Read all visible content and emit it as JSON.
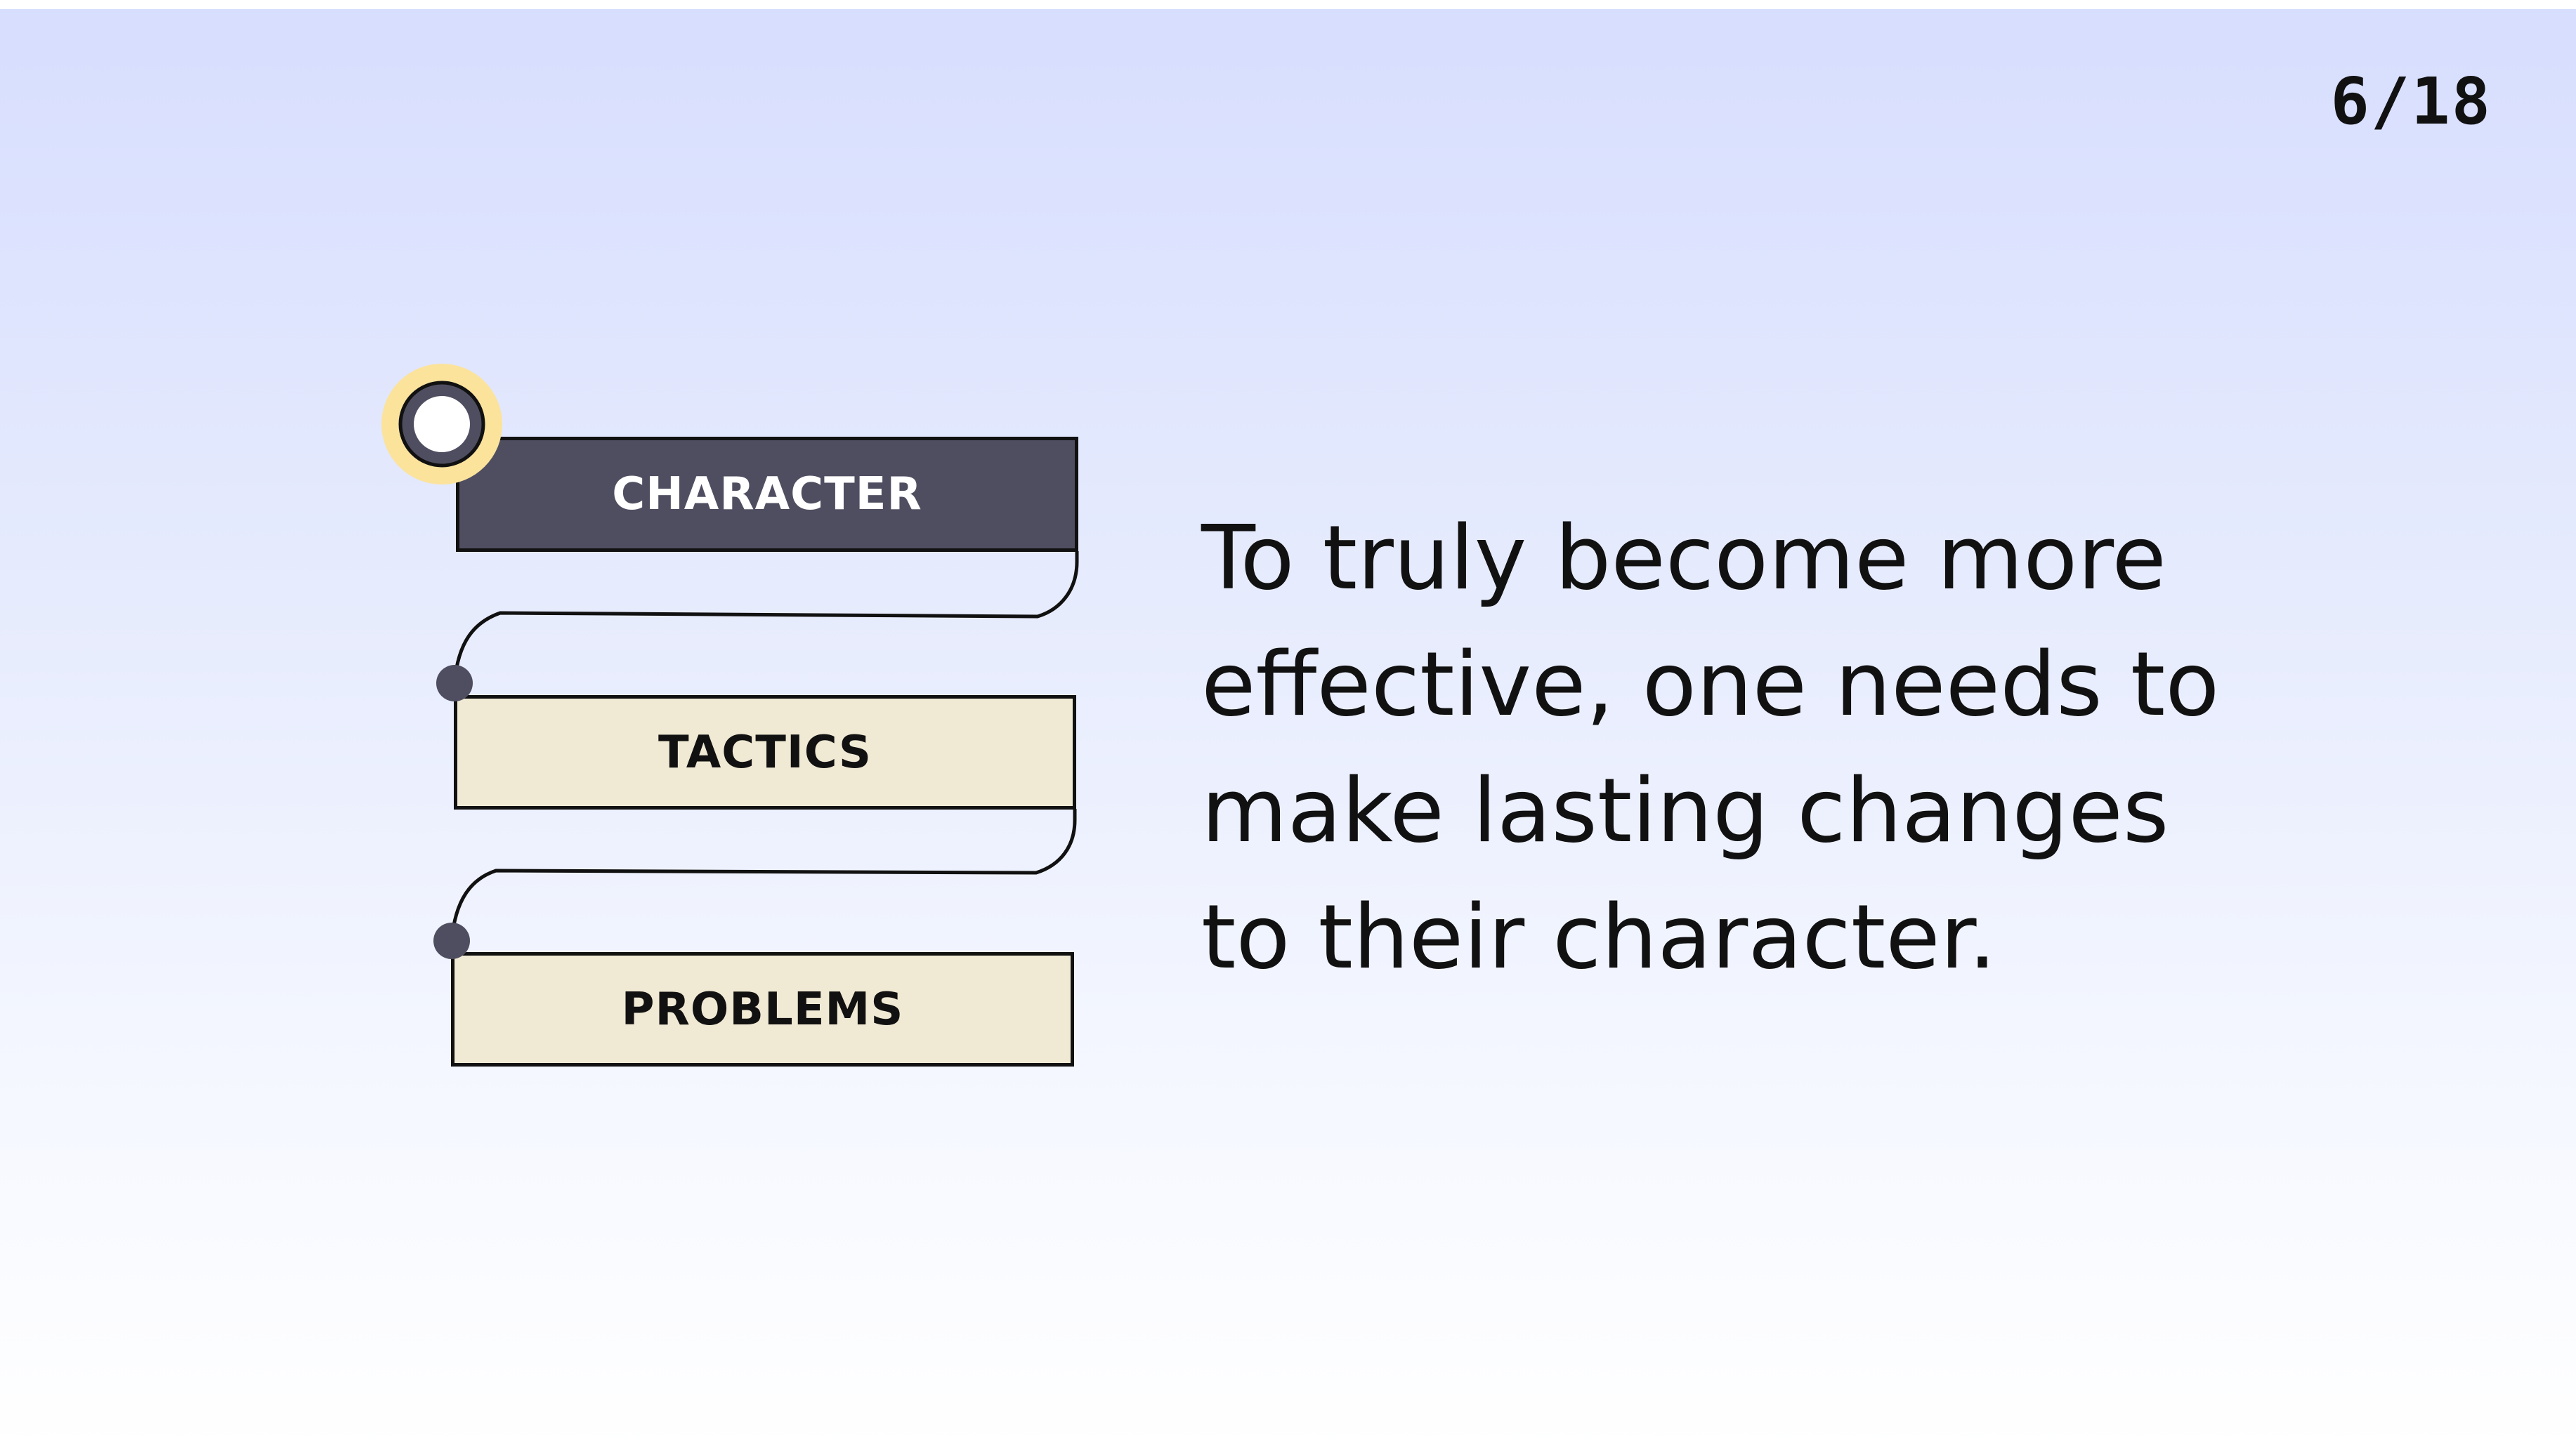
{
  "page_indicator": "6/18",
  "steps": [
    {
      "label": "CHARACTER",
      "active": true
    },
    {
      "label": "TACTICS",
      "active": false
    },
    {
      "label": "PROBLEMS",
      "active": false
    }
  ],
  "body_text": "To truly become more effective, one needs to make lasting changes to their character.",
  "colors": {
    "active_box": "#4f4e61",
    "inactive_box": "#f0e9d4",
    "highlight": "#fbe39c",
    "background_top": "#d7defe"
  }
}
